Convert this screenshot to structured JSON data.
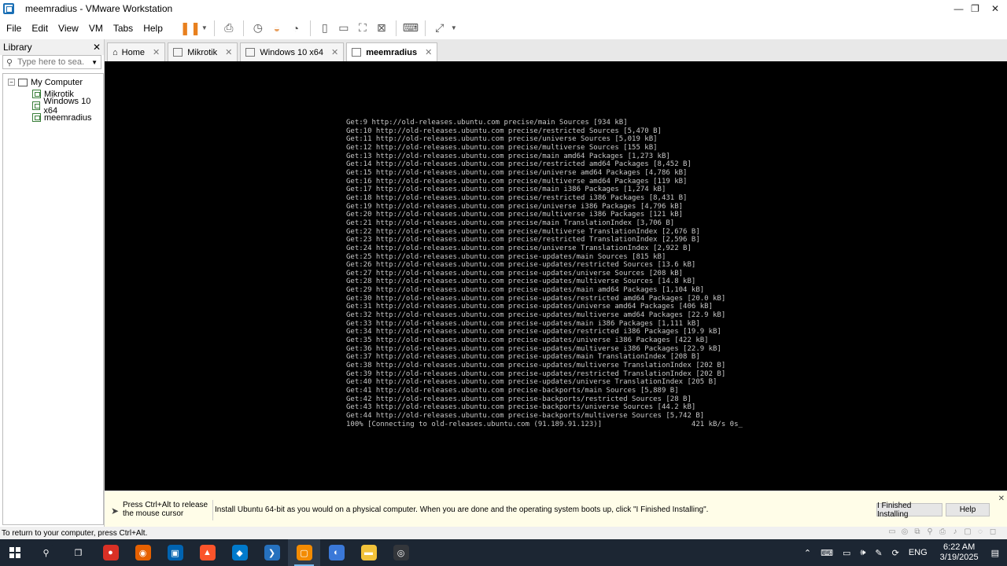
{
  "window": {
    "title": "meemradius - VMware Workstation",
    "min": "—",
    "max": "❐",
    "close": "✕"
  },
  "menu": [
    "File",
    "Edit",
    "View",
    "VM",
    "Tabs",
    "Help"
  ],
  "library": {
    "title": "Library",
    "close": "✕",
    "search_placeholder": "Type here to sea...",
    "root": "My Computer",
    "vms": [
      "Mikrotik",
      "Windows 10 x64",
      "meemradius"
    ]
  },
  "tabs": [
    {
      "label": "Home",
      "close": "✕"
    },
    {
      "label": "Mikrotik",
      "close": "✕"
    },
    {
      "label": "Windows 10 x64",
      "close": "✕"
    },
    {
      "label": "meemradius",
      "close": "✕"
    }
  ],
  "console": {
    "lines": [
      "Get:9 http://old-releases.ubuntu.com precise/main Sources [934 kB]",
      "Get:10 http://old-releases.ubuntu.com precise/restricted Sources [5,470 B]",
      "Get:11 http://old-releases.ubuntu.com precise/universe Sources [5,019 kB]",
      "Get:12 http://old-releases.ubuntu.com precise/multiverse Sources [155 kB]",
      "Get:13 http://old-releases.ubuntu.com precise/main amd64 Packages [1,273 kB]",
      "Get:14 http://old-releases.ubuntu.com precise/restricted amd64 Packages [8,452 B]",
      "Get:15 http://old-releases.ubuntu.com precise/universe amd64 Packages [4,786 kB]",
      "Get:16 http://old-releases.ubuntu.com precise/multiverse amd64 Packages [119 kB]",
      "Get:17 http://old-releases.ubuntu.com precise/main i386 Packages [1,274 kB]",
      "Get:18 http://old-releases.ubuntu.com precise/restricted i386 Packages [8,431 B]",
      "Get:19 http://old-releases.ubuntu.com precise/universe i386 Packages [4,796 kB]",
      "Get:20 http://old-releases.ubuntu.com precise/multiverse i386 Packages [121 kB]",
      "Get:21 http://old-releases.ubuntu.com precise/main TranslationIndex [3,706 B]",
      "Get:22 http://old-releases.ubuntu.com precise/multiverse TranslationIndex [2,676 B]",
      "Get:23 http://old-releases.ubuntu.com precise/restricted TranslationIndex [2,596 B]",
      "Get:24 http://old-releases.ubuntu.com precise/universe TranslationIndex [2,922 B]",
      "Get:25 http://old-releases.ubuntu.com precise-updates/main Sources [815 kB]",
      "Get:26 http://old-releases.ubuntu.com precise-updates/restricted Sources [13.6 kB]",
      "Get:27 http://old-releases.ubuntu.com precise-updates/universe Sources [208 kB]",
      "Get:28 http://old-releases.ubuntu.com precise-updates/multiverse Sources [14.8 kB]",
      "Get:29 http://old-releases.ubuntu.com precise-updates/main amd64 Packages [1,104 kB]",
      "Get:30 http://old-releases.ubuntu.com precise-updates/restricted amd64 Packages [20.0 kB]",
      "Get:31 http://old-releases.ubuntu.com precise-updates/universe amd64 Packages [406 kB]",
      "Get:32 http://old-releases.ubuntu.com precise-updates/multiverse amd64 Packages [22.9 kB]",
      "Get:33 http://old-releases.ubuntu.com precise-updates/main i386 Packages [1,111 kB]",
      "Get:34 http://old-releases.ubuntu.com precise-updates/restricted i386 Packages [19.9 kB]",
      "Get:35 http://old-releases.ubuntu.com precise-updates/universe i386 Packages [422 kB]",
      "Get:36 http://old-releases.ubuntu.com precise-updates/multiverse i386 Packages [22.9 kB]",
      "Get:37 http://old-releases.ubuntu.com precise-updates/main TranslationIndex [208 B]",
      "Get:38 http://old-releases.ubuntu.com precise-updates/multiverse TranslationIndex [202 B]",
      "Get:39 http://old-releases.ubuntu.com precise-updates/restricted TranslationIndex [202 B]",
      "Get:40 http://old-releases.ubuntu.com precise-updates/universe TranslationIndex [205 B]",
      "Get:41 http://old-releases.ubuntu.com precise-backports/main Sources [5,889 B]",
      "Get:42 http://old-releases.ubuntu.com precise-backports/restricted Sources [28 B]",
      "Get:43 http://old-releases.ubuntu.com precise-backports/universe Sources [44.2 kB]",
      "Get:44 http://old-releases.ubuntu.com precise-backports/multiverse Sources [5,742 B]",
      "100% [Connecting to old-releases.ubuntu.com (91.189.91.123)]                     421 kB/s 0s_"
    ]
  },
  "hint": {
    "release": "Press Ctrl+Alt to release the mouse cursor",
    "message": "Install Ubuntu 64-bit as you would on a physical computer. When you are done and the operating system boots up, click \"I Finished Installing\".",
    "finish_button": "I Finished Installing",
    "help_button": "Help",
    "close": "✕"
  },
  "status": {
    "text": "To return to your computer, press Ctrl+Alt."
  },
  "taskbar": {
    "apps": [
      {
        "name": "search",
        "glyph": "⚲",
        "color": "#1c2633"
      },
      {
        "name": "task-view",
        "glyph": "❐",
        "color": "#1c2633"
      },
      {
        "name": "chrome",
        "glyph": "●",
        "color": "#d93025"
      },
      {
        "name": "firefox",
        "glyph": "◉",
        "color": "#e66000"
      },
      {
        "name": "ms-store",
        "glyph": "▣",
        "color": "#0063b1"
      },
      {
        "name": "brave",
        "glyph": "▲",
        "color": "#fb542b"
      },
      {
        "name": "vscode",
        "glyph": "◆",
        "color": "#007acc"
      },
      {
        "name": "powershell",
        "glyph": "❯",
        "color": "#2671be"
      },
      {
        "name": "vmware",
        "glyph": "▢",
        "color": "#f38b00"
      },
      {
        "name": "app-blue",
        "glyph": "◐",
        "color": "#3a78d8"
      },
      {
        "name": "file-explorer",
        "glyph": "▬",
        "color": "#f2c23a"
      },
      {
        "name": "obs",
        "glyph": "◎",
        "color": "#33363b"
      }
    ],
    "lang": "ENG",
    "time": "6:22 AM",
    "date": "3/19/2025"
  }
}
